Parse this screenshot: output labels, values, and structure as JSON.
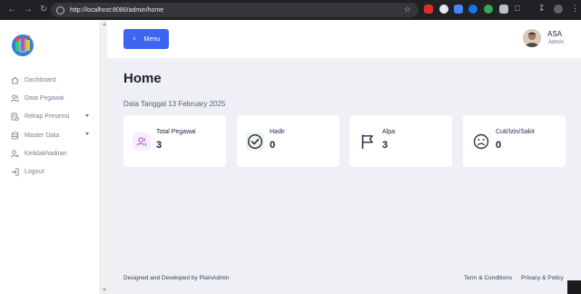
{
  "browser": {
    "url": "http://localhost:8080/admin/home",
    "back_icon": "arrow-left-icon",
    "forward_icon": "arrow-right-icon",
    "reload_icon": "reload-icon"
  },
  "sidebar": {
    "items": [
      {
        "label": "Dashboard",
        "icon": "home-icon"
      },
      {
        "label": "Data Pegawai",
        "icon": "users-icon"
      },
      {
        "label": "Rekap Presensi",
        "icon": "report-icon",
        "has_submenu": true
      },
      {
        "label": "Master Data",
        "icon": "database-icon",
        "has_submenu": true
      },
      {
        "label": "Ketidakhadiran",
        "icon": "user-absent-icon"
      },
      {
        "label": "Logout",
        "icon": "logout-icon"
      }
    ]
  },
  "header": {
    "menu_button_label": "Menu",
    "user_name": "ASA",
    "user_role": "Admin"
  },
  "main": {
    "title": "Home",
    "date_line": "Data Tanggal 13 February 2025",
    "cards": [
      {
        "label": "Total Pegawai",
        "value": "3",
        "icon": "users-icon"
      },
      {
        "label": "Hadir",
        "value": "0",
        "icon": "check-circle-icon"
      },
      {
        "label": "Alpa",
        "value": "3",
        "icon": "flag-icon"
      },
      {
        "label": "Cuti/Izin/Sakit",
        "value": "0",
        "icon": "sad-face-icon"
      }
    ]
  },
  "footer": {
    "credit": "Designed and Developed by PlainAdmin",
    "terms": "Term & Conditions",
    "privacy": "Privacy & Policy"
  },
  "colors": {
    "accent": "#3e64f0",
    "sidebar_text": "#7a7f92",
    "page_bg": "#eef0f5"
  }
}
